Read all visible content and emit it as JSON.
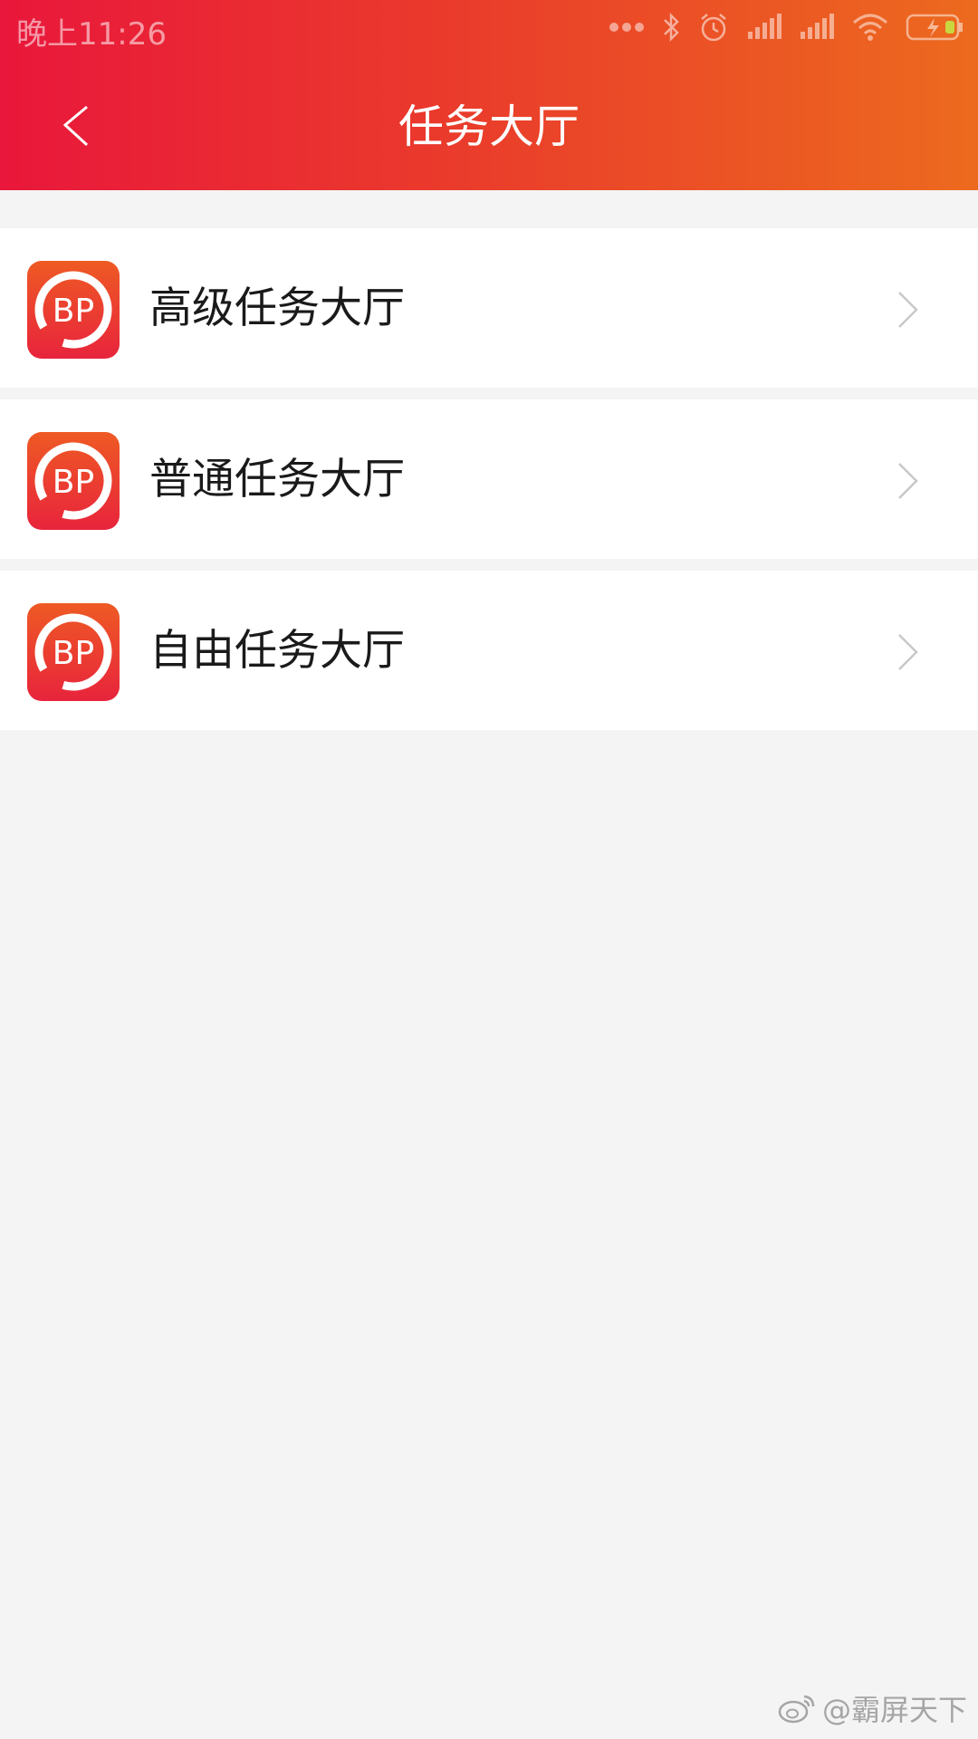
{
  "status_bar": {
    "time": "晚上11:26",
    "icons": [
      "more-dots-icon",
      "bluetooth-icon",
      "alarm-icon",
      "signal-icon",
      "signal-icon",
      "wifi-icon",
      "battery-charging-icon"
    ]
  },
  "nav": {
    "title": "任务大厅",
    "back_icon": "chevron-left-icon"
  },
  "items": [
    {
      "label": "高级任务大厅",
      "icon": "bp-logo-icon",
      "logo_text": "BP"
    },
    {
      "label": "普通任务大厅",
      "icon": "bp-logo-icon",
      "logo_text": "BP"
    },
    {
      "label": "自由任务大厅",
      "icon": "bp-logo-icon",
      "logo_text": "BP"
    }
  ],
  "watermark": {
    "text": "@霸屏天下",
    "icon": "weibo-icon"
  },
  "colors": {
    "header_start": "#e9173b",
    "header_end": "#ec6a1e",
    "background": "#f4f4f4",
    "item_bg": "#ffffff"
  }
}
